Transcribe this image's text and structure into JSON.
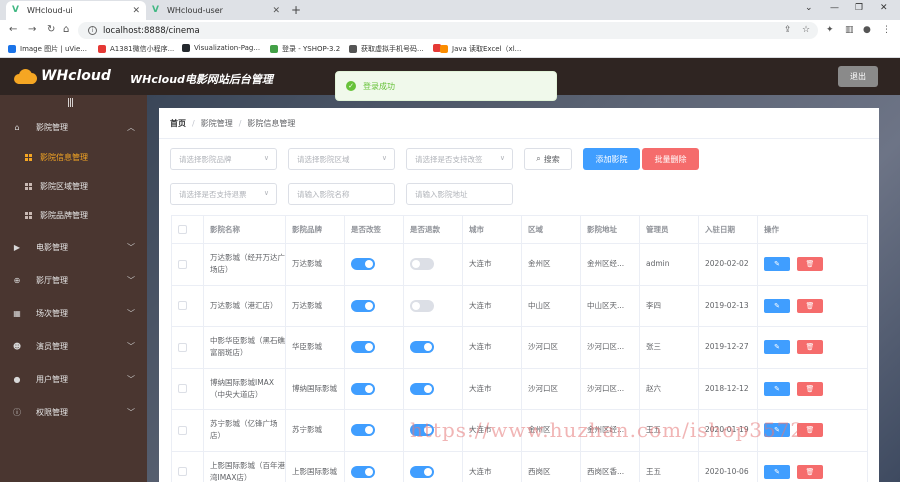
{
  "browser": {
    "tabs": [
      {
        "title": "WHcloud-ui",
        "active": true
      },
      {
        "title": "WHcloud-user",
        "active": false
      }
    ],
    "url": "localhost:8888/cinema",
    "bookmarks": [
      {
        "label": "Image 图片 | uVie...",
        "color": "#1a73e8"
      },
      {
        "label": "A1381微信小程序...",
        "color": "#e53935"
      },
      {
        "label": "Visualization-Pag...",
        "color": "#24292e"
      },
      {
        "label": "登录 - YSHOP-3.2",
        "color": "#43a047"
      },
      {
        "label": "获取虚拟手机号码...",
        "color": "#555555"
      },
      {
        "label": "",
        "color": "#e53935"
      },
      {
        "label": "Java 读取Excel（xl...",
        "color": "#fb8c00"
      }
    ]
  },
  "header": {
    "logo_text": "WHcloud",
    "title": "WHcloud电影网站后台管理",
    "logout_label": "退出"
  },
  "toast": {
    "message": "登录成功",
    "color": "#67c23a"
  },
  "sidebar": {
    "collapse_glyph": "|||",
    "groups": [
      {
        "label": "影院管理",
        "icon": "home-icon",
        "expanded": true,
        "children": [
          {
            "label": "影院信息管理",
            "active": true
          },
          {
            "label": "影院区域管理",
            "active": false
          },
          {
            "label": "影院品牌管理",
            "active": false
          }
        ]
      },
      {
        "label": "电影管理",
        "icon": "film-icon"
      },
      {
        "label": "影厅管理",
        "icon": "hall-icon"
      },
      {
        "label": "场次管理",
        "icon": "schedule-icon"
      },
      {
        "label": "演员管理",
        "icon": "actor-icon"
      },
      {
        "label": "用户管理",
        "icon": "user-icon"
      },
      {
        "label": "权限管理",
        "icon": "permission-icon"
      }
    ]
  },
  "breadcrumb": [
    "首页",
    "影院管理",
    "影院信息管理"
  ],
  "filters": {
    "brand_placeholder": "请选择影院品牌",
    "region_placeholder": "请选择影院区域",
    "upgrade_placeholder": "请选择是否支持改签",
    "refund_placeholder": "请选择是否支持退票",
    "name_placeholder": "请输入影院名称",
    "address_placeholder": "请输入影院地址",
    "search_label": "搜索",
    "add_label": "添加影院",
    "batch_delete_label": "批量删除"
  },
  "table": {
    "columns": [
      "影院名称",
      "影院品牌",
      "是否改签",
      "是否退款",
      "城市",
      "区域",
      "影院地址",
      "管理员",
      "入驻日期",
      "操作"
    ],
    "rows": [
      {
        "name": "万达影城（经开万达广场店）",
        "brand": "万达影城",
        "change": true,
        "refund": false,
        "city": "大连市",
        "area": "金州区",
        "address": "金州区经...",
        "admin": "admin",
        "date": "2020-02-02"
      },
      {
        "name": "万达影城（港汇店）",
        "brand": "万达影城",
        "change": true,
        "refund": false,
        "city": "大连市",
        "area": "中山区",
        "address": "中山区天...",
        "admin": "李四",
        "date": "2019-02-13"
      },
      {
        "name": "中影华臣影城（黑石礁富丽斑店）",
        "brand": "华臣影城",
        "change": true,
        "refund": true,
        "city": "大连市",
        "area": "沙河口区",
        "address": "沙河口区...",
        "admin": "张三",
        "date": "2019-12-27"
      },
      {
        "name": "博纳国际影城IMAX（中央大道店）",
        "brand": "博纳国际影城",
        "change": true,
        "refund": true,
        "city": "大连市",
        "area": "沙河口区",
        "address": "沙河口区...",
        "admin": "赵六",
        "date": "2018-12-12"
      },
      {
        "name": "苏宁影城（亿锋广场店）",
        "brand": "苏宁影城",
        "change": true,
        "refund": true,
        "city": "大连市",
        "area": "金州区",
        "address": "金州区经...",
        "admin": "王五",
        "date": "2020-01-19"
      },
      {
        "name": "上影国际影城（百年港湾IMAX店）",
        "brand": "上影国际影城",
        "change": true,
        "refund": true,
        "city": "大连市",
        "area": "西岗区",
        "address": "西岗区香...",
        "admin": "王五",
        "date": "2020-10-06"
      }
    ]
  },
  "watermark": "https://www.huzhan.com/ishop3572"
}
